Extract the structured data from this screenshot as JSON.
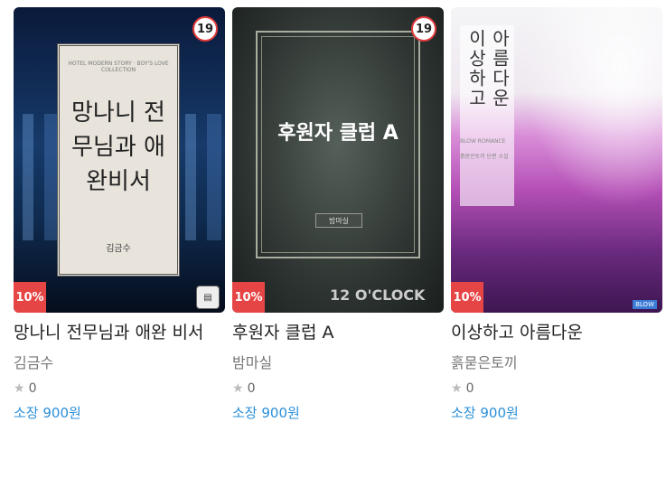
{
  "books": [
    {
      "title": "망나니 전무님과 애완 비서",
      "author": "김금수",
      "rating": "0",
      "price": "소장 900원",
      "discount": "10%",
      "age_rating": "19",
      "cover": {
        "title": "망나니 전무님과 애완비서",
        "author": "김금수",
        "tagline": "HOTEL MODERN STORY · BOY'S LOVE COLLECTION"
      }
    },
    {
      "title": "후원자 클럽 A",
      "author": "밤마실",
      "rating": "0",
      "price": "소장 900원",
      "discount": "10%",
      "age_rating": "19",
      "cover": {
        "title": "후원자 클럽 A",
        "author": "밤마실",
        "publisher": "12 O'CLOCK"
      }
    },
    {
      "title": "이상하고 아름다운",
      "author": "흙묻은토끼",
      "rating": "0",
      "price": "소장 900원",
      "discount": "10%",
      "cover": {
        "title_line1": "이상하고",
        "title_line2": "아름다운",
        "series": "BLOW ROMANCE",
        "author_caption": "흙묻은토끼 단편 소설",
        "publisher": "BLOW"
      }
    }
  ]
}
